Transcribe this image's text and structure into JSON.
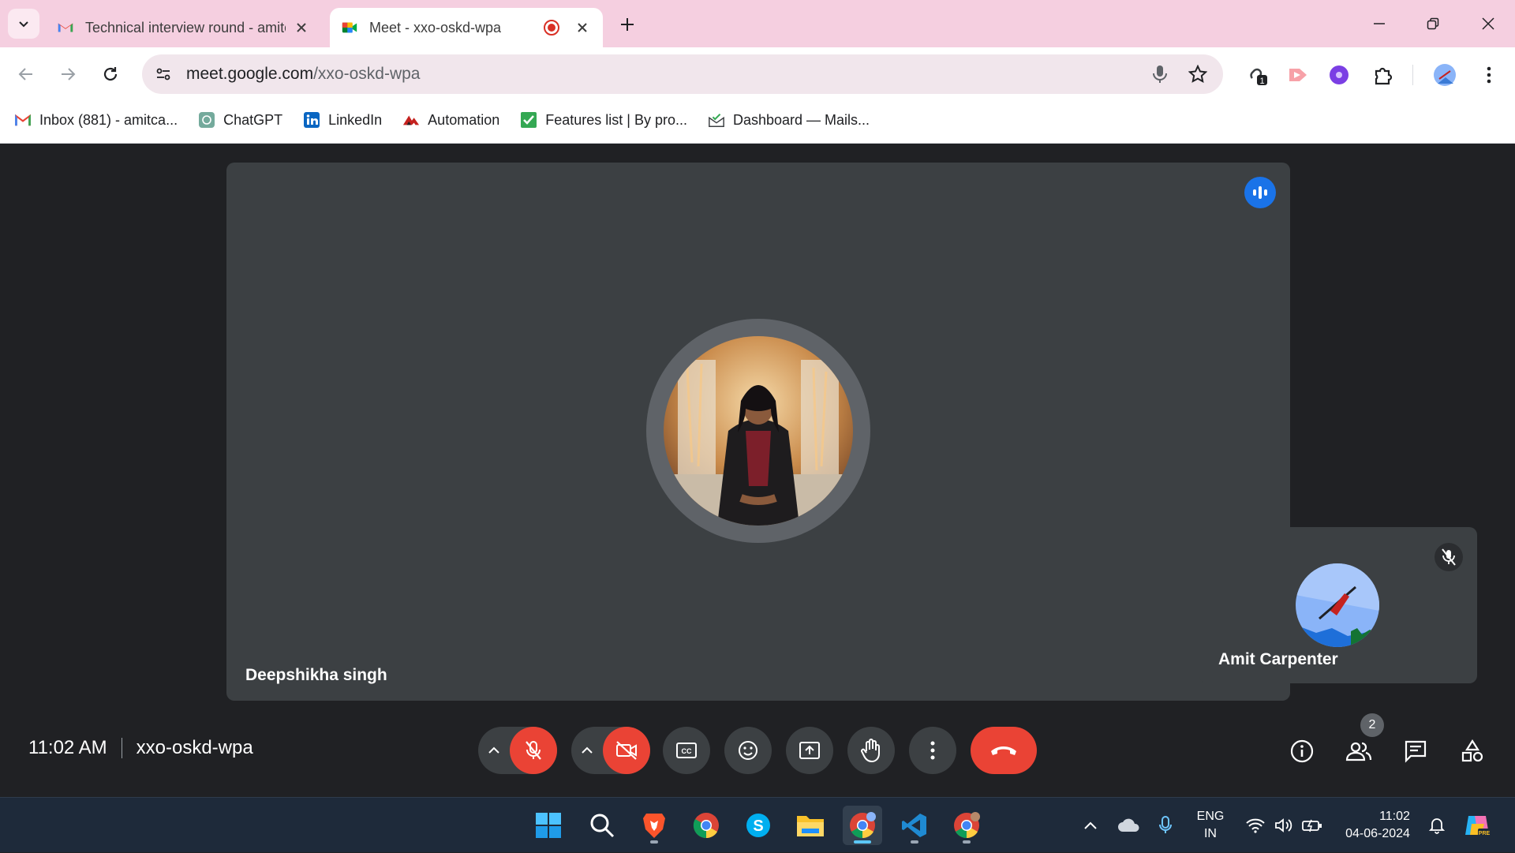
{
  "browser": {
    "tabs": [
      {
        "title": "Technical interview round - amitcarpenter",
        "favicon": "gmail-icon",
        "active": false
      },
      {
        "title": "Meet - xxo-oskd-wpa",
        "favicon": "google-meet-icon",
        "active": true,
        "recording": true
      }
    ],
    "url": {
      "host": "meet.google.com",
      "path": "/xxo-oskd-wpa"
    },
    "extension_badge": "1",
    "bookmarks": [
      {
        "label": "Inbox (881) - amitca...",
        "icon": "gmail-icon"
      },
      {
        "label": "ChatGPT",
        "icon": "chatgpt-icon"
      },
      {
        "label": "LinkedIn",
        "icon": "linkedin-icon"
      },
      {
        "label": "Automation",
        "icon": "automation-icon"
      },
      {
        "label": "Features list | By pro...",
        "icon": "checkmark-icon"
      },
      {
        "label": "Dashboard — Mails...",
        "icon": "mail-dashboard-icon"
      }
    ]
  },
  "meet": {
    "main_participant": {
      "name": "Deepshikha singh",
      "speaking": true
    },
    "self_participant": {
      "name": "Amit Carpenter",
      "muted": true
    },
    "time": "11:02 AM",
    "meeting_code": "xxo-oskd-wpa",
    "participants_count": "2",
    "mic_on": false,
    "camera_on": false
  },
  "taskbar": {
    "language": {
      "line1": "ENG",
      "line2": "IN"
    },
    "time": "11:02",
    "date": "04-06-2024"
  },
  "colors": {
    "meet_bg": "#202124",
    "tile_bg": "#3c4043",
    "accent_red": "#ea4335",
    "accent_blue": "#1a73e8",
    "tabbar_bg": "#f5cfe0"
  }
}
